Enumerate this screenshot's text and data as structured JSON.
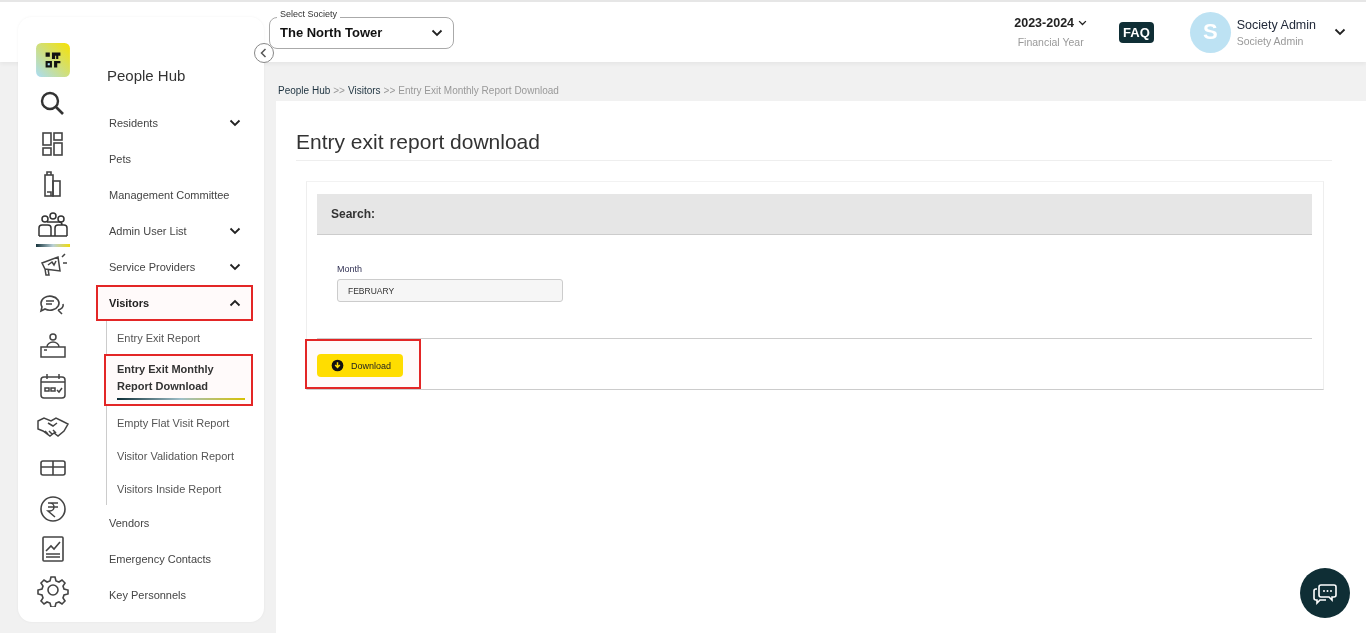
{
  "header": {
    "society_select": {
      "label": "Select Society",
      "value": "The North Tower"
    },
    "financial_year": {
      "value": "2023-2024",
      "caption": "Financial Year"
    },
    "faq": "FAQ",
    "user": {
      "initial": "S",
      "name": "Society Admin",
      "role": "Society Admin"
    }
  },
  "rail": [
    {
      "selected": false
    },
    {
      "selected": false
    },
    {
      "selected": false
    },
    {
      "selected": true
    },
    {
      "selected": false
    },
    {
      "selected": false
    },
    {
      "selected": false
    },
    {
      "selected": false
    },
    {
      "selected": false
    },
    {
      "selected": false
    },
    {
      "selected": false
    },
    {
      "selected": false
    },
    {
      "selected": false
    }
  ],
  "sidebar": {
    "title": "People Hub",
    "items": [
      {
        "label": "Residents",
        "expandable": true,
        "expanded": false,
        "highlighted": false
      },
      {
        "label": "Pets",
        "expandable": false,
        "highlighted": false
      },
      {
        "label": "Management Committee",
        "expandable": false,
        "highlighted": false
      },
      {
        "label": "Admin User List",
        "expandable": true,
        "expanded": false,
        "highlighted": false
      },
      {
        "label": "Service Providers",
        "expandable": true,
        "expanded": false,
        "highlighted": false
      },
      {
        "label": "Visitors",
        "expandable": true,
        "expanded": true,
        "highlighted": true,
        "children": [
          {
            "label": "Entry Exit Report",
            "selected": false,
            "highlighted": false
          },
          {
            "label": "Entry Exit Monthly Report Download",
            "selected": true,
            "highlighted": true
          },
          {
            "label": "Empty Flat Visit Report",
            "selected": false,
            "highlighted": false
          },
          {
            "label": "Visitor Validation Report",
            "selected": false,
            "highlighted": false
          },
          {
            "label": "Visitors Inside Report",
            "selected": false,
            "highlighted": false
          }
        ]
      },
      {
        "label": "Vendors",
        "expandable": false,
        "highlighted": false
      },
      {
        "label": "Emergency Contacts",
        "expandable": false,
        "highlighted": false
      },
      {
        "label": "Key Personnels",
        "expandable": false,
        "highlighted": false
      }
    ]
  },
  "breadcrumb": [
    {
      "label": "People Hub",
      "current": false
    },
    {
      "label": "Visitors",
      "current": false
    },
    {
      "label": "Entry Exit Monthly Report Download",
      "current": true
    }
  ],
  "breadcrumb_separator": ">>",
  "page_title": "Entry exit report download",
  "search_panel": {
    "title": "Search:",
    "month": {
      "label": "Month",
      "value": "FEBRUARY"
    }
  },
  "download_button": {
    "label": "Download",
    "highlighted": true
  }
}
